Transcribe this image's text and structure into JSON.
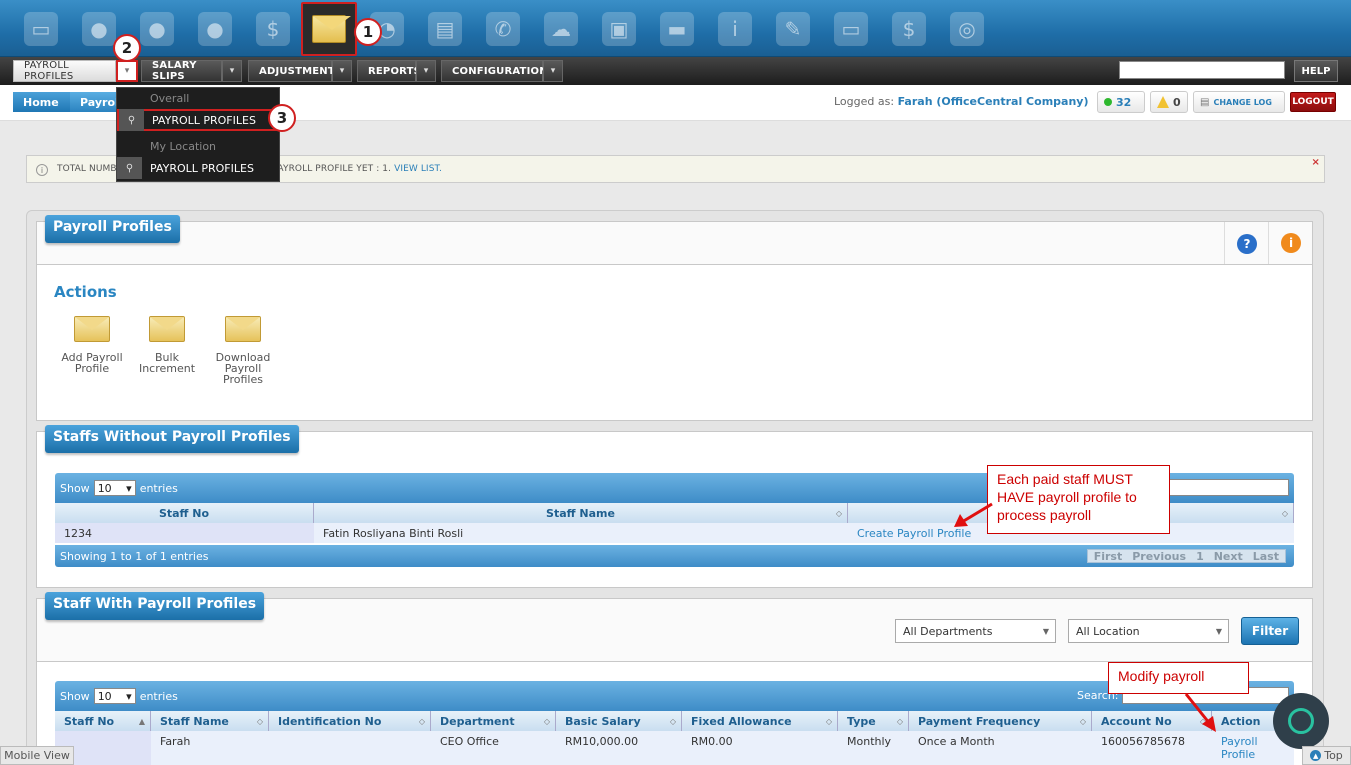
{
  "topbar": {
    "icons": [
      "monitor-icon",
      "user-icon",
      "user-icon",
      "user-icon",
      "coins-icon",
      "envelope-icon",
      "chart-icon",
      "document-icon",
      "phone-icon",
      "chat-icon",
      "save-icon",
      "truck-icon",
      "info-icon",
      "notes-icon",
      "display-icon",
      "lock-icon",
      "gauge-icon"
    ],
    "active_icon": "envelope-icon",
    "step1": "1"
  },
  "menubar": {
    "payroll_profiles": "PAYROLL PROFILES",
    "salary_slips": "SALARY SLIPS",
    "adjustments": "ADJUSTMENTS",
    "reports": "REPORTS",
    "configurations": "CONFIGURATIONS",
    "help": "HELP",
    "step2": "2"
  },
  "dropdown": {
    "section_overall": "Overall",
    "item_overall": "PAYROLL PROFILES",
    "section_location": "My Location",
    "item_location": "PAYROLL PROFILES",
    "step3": "3"
  },
  "breadcrumb": {
    "home": "Home",
    "current": "Payroll"
  },
  "user": {
    "logged_label": "Logged as:",
    "name": "Farah (OfficeCentral Company)",
    "online_count": "32",
    "warning_count": "0",
    "change_log": "CHANGE LOG",
    "logout": "LOGOUT"
  },
  "notice": {
    "text_start": "TOTAL NUMBE",
    "text_end": "PAYROLL PROFILE YET : 1.",
    "link": "VIEW LIST.",
    "close": "×"
  },
  "payroll_profiles_panel": {
    "title": "Payroll Profiles",
    "actions_title": "Actions",
    "actions": [
      {
        "label_1": "Add Payroll",
        "label_2": "Profile",
        "label_3": ""
      },
      {
        "label_1": "Bulk",
        "label_2": "Increment",
        "label_3": ""
      },
      {
        "label_1": "Download",
        "label_2": "Payroll",
        "label_3": "Profiles"
      }
    ]
  },
  "without_panel": {
    "title": "Staffs Without Payroll Profiles",
    "show": "Show",
    "entries_value": "10",
    "entries": "entries",
    "columns": [
      "Staff No",
      "Staff Name",
      ""
    ],
    "rows": [
      {
        "staff_no": "1234",
        "staff_name": "Fatin Rosliyana Binti Rosli",
        "action": "Create Payroll Profile"
      }
    ],
    "showing": "Showing 1 to 1 of 1 entries",
    "pager": {
      "first": "First",
      "previous": "Previous",
      "page": "1",
      "next": "Next",
      "last": "Last"
    },
    "callout": [
      "Each paid staff MUST",
      "HAVE payroll profile to",
      "process payroll"
    ]
  },
  "with_panel": {
    "title": "Staff With Payroll Profiles",
    "department_select": "All Departments",
    "location_select": "All Location",
    "filter": "Filter",
    "show": "Show",
    "entries_value": "10",
    "entries": "entries",
    "search_label": "Search:",
    "columns": [
      "Staff No",
      "Staff Name",
      "Identification No",
      "Department",
      "Basic Salary",
      "Fixed Allowance",
      "Type",
      "Payment Frequency",
      "Account No",
      "Action"
    ],
    "rows": [
      {
        "staff_no": "",
        "staff_name": "Farah",
        "id_no": "",
        "department": "CEO Office",
        "basic_salary": "RM10,000.00",
        "fixed_allowance": "RM0.00",
        "type": "Monthly",
        "frequency": "Once a Month",
        "account_no": "160056785678",
        "action_1": "Payroll",
        "action_2": "Profile"
      }
    ],
    "callout": "Modify payroll"
  },
  "footer": {
    "mobile_view": "Mobile View",
    "top": "Top"
  },
  "colors": {
    "accent": "#2a86c2",
    "annotation": "#d02020",
    "header_blue": "#1f77b4"
  }
}
